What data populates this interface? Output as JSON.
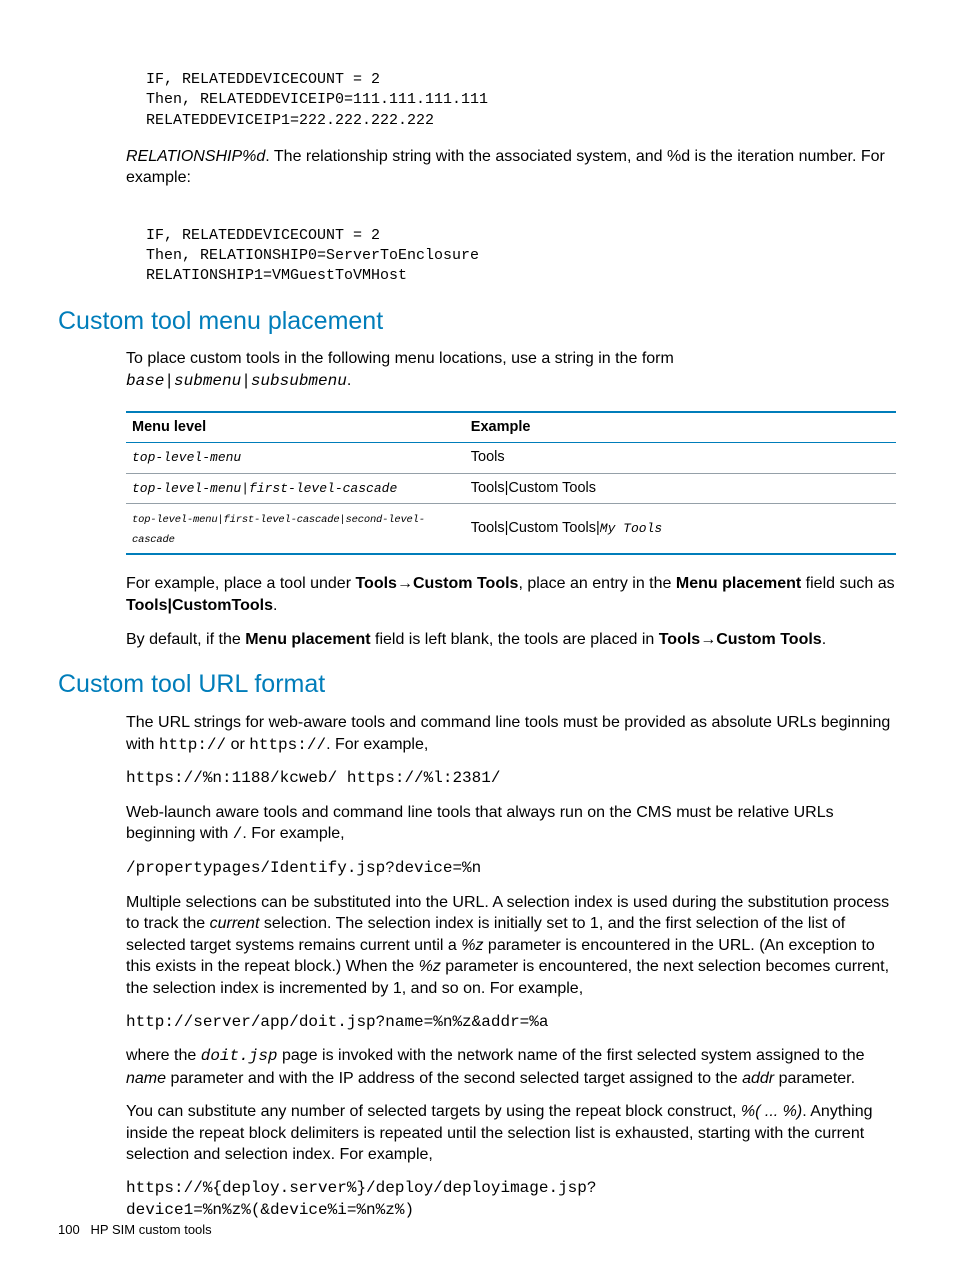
{
  "code1": "IF, RELATEDDEVICECOUNT = 2\nThen, RELATEDDEVICEIP0=111.111.111.111\nRELATEDDEVICEIP1=222.222.222.222",
  "para1_pre_italic": "RELATIONSHIP%d",
  "para1_rest": ". The relationship string with the associated system, and %d is the iteration number. For example:",
  "code2": "IF, RELATEDDEVICECOUNT = 2\nThen, RELATIONSHIP0=ServerToEnclosure\nRELATIONSHIP1=VMGuestToVMHost",
  "h2a": "Custom tool menu placement",
  "para2_a": "To place custom tools in the following menu locations, use a string in the form ",
  "para2_mono": "base|submenu|subsubmenu",
  "para2_b": ".",
  "table": {
    "h1": "Menu level",
    "h2": "Example",
    "r1c1": "top-level-menu",
    "r1c2": "Tools",
    "r2c1": "top-level-menu|first-level-cascade",
    "r2c2": "Tools|Custom Tools",
    "r3c1": "top-level-menu|first-level-cascade|second-level-cascade",
    "r3c2_a": "Tools|Custom Tools|",
    "r3c2_mono": "My Tools"
  },
  "para3_a": "For example, place a tool under ",
  "para3_b1": "Tools",
  "para3_arrow": "→",
  "para3_b2": "Custom Tools",
  "para3_c": ", place an entry in the ",
  "para3_b3": "Menu placement",
  "para3_d": " field such as ",
  "para3_b4": "Tools|CustomTools",
  "para3_e": ".",
  "para4_a": "By default, if the ",
  "para4_b1": "Menu placement",
  "para4_b": " field is left blank, the tools are placed in ",
  "para4_b2": "Tools",
  "para4_c": "→",
  "para4_b3": "Custom Tools",
  "para4_d": ".",
  "h2b": "Custom tool URL format",
  "para5_a": "The URL strings for web-aware tools and command line tools must be provided as absolute URLs beginning with ",
  "para5_m1": "http://",
  "para5_b": " or ",
  "para5_m2": "https://",
  "para5_c": ". For example,",
  "code3": "https://%n:1188/kcweb/ https://%l:2381/",
  "para6_a": "Web-launch aware tools and command line tools that always run on the CMS must be relative URLs beginning with ",
  "para6_m": "/",
  "para6_b": ". For example,",
  "code4": "/propertypages/Identify.jsp?device=%n",
  "para7_a": "Multiple selections can be substituted into the URL. A selection index is used during the substitution process to track the ",
  "para7_i1": "current",
  "para7_b": " selection. The selection index is initially set to 1, and the first selection of the list of selected target systems remains current until a ",
  "para7_i2": "%z",
  "para7_c": " parameter is encountered in the URL. (An exception to this exists in the repeat block.) When the ",
  "para7_i3": "%z",
  "para7_d": " parameter is encountered, the next selection becomes current, the selection index is incremented by 1, and so on. For example,",
  "code5": "http://server/app/doit.jsp?name=%n%z&addr=%a",
  "para8_a": "where the ",
  "para8_m": "doit.jsp",
  "para8_b": " page is invoked with the network name of the first selected system assigned to the ",
  "para8_i1": "name",
  "para8_c": " parameter and with the IP address of the second selected target assigned to the ",
  "para8_i2": "addr",
  "para8_d": " parameter.",
  "para9_a": "You can substitute any number of selected targets by using the repeat block construct, ",
  "para9_i": "%( ... %)",
  "para9_b": ". Anything inside the repeat block delimiters is repeated until the selection list is exhausted, starting with the current selection and selection index. For example,",
  "code6": "https://%{deploy.server%}/deploy/deployimage.jsp?\ndevice1=%n%z%(&device%i=%n%z%)",
  "footer_num": "100",
  "footer_text": "HP SIM custom tools"
}
